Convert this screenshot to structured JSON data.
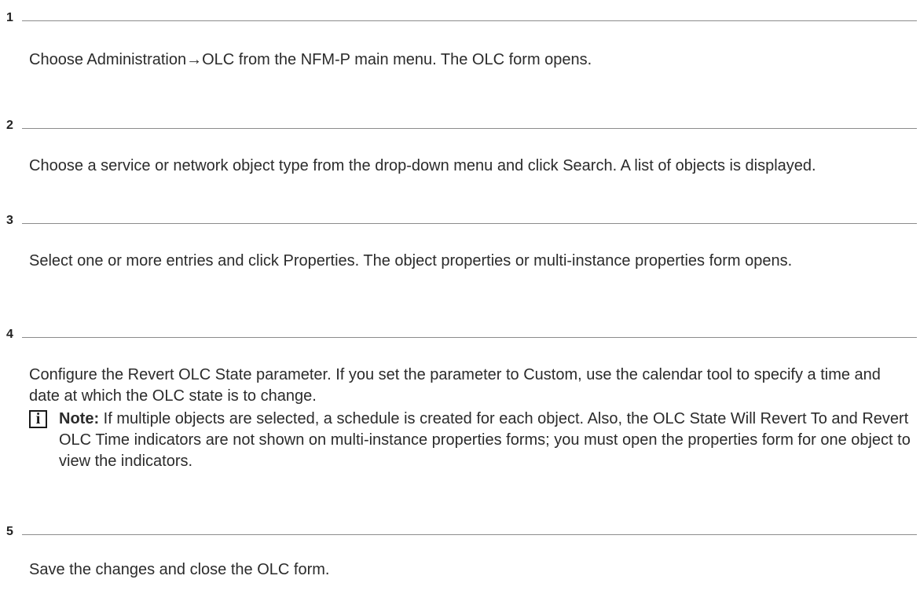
{
  "steps": [
    {
      "number": "1",
      "text": "Choose Administration→OLC from the NFM-P main menu. The OLC form opens."
    },
    {
      "number": "2",
      "text": "Choose a service or network object type from the drop-down menu and click Search. A list of objects is displayed."
    },
    {
      "number": "3",
      "text": "Select one or more entries and click Properties. The object properties or multi-instance properties form opens."
    },
    {
      "number": "4",
      "text": "Configure the Revert OLC State parameter. If you set the parameter to Custom, use the calendar tool to specify a time and date at which the OLC state is to change.",
      "note": {
        "icon": "info-icon",
        "label": "Note:",
        "text": " If multiple objects are selected, a schedule is created for each object. Also, the OLC State Will Revert To and Revert OLC Time indicators are not shown on multi-instance properties forms; you must open the properties form for one object to view the indicators."
      }
    },
    {
      "number": "5",
      "text": "Save the changes and close the OLC form."
    }
  ]
}
